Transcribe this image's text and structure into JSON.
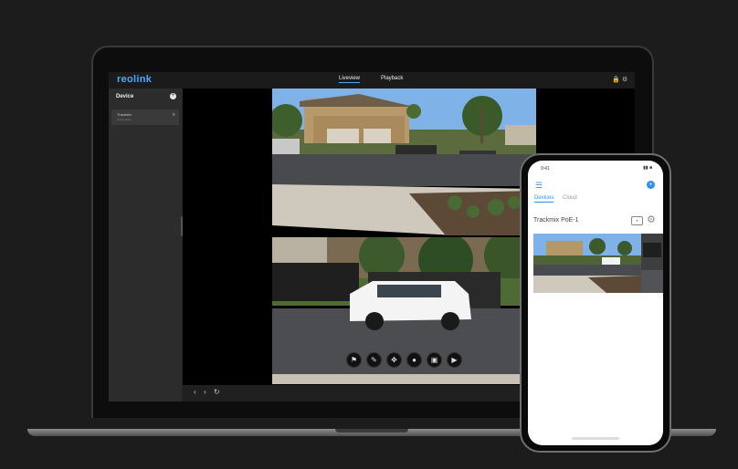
{
  "app": {
    "logo": "reolink",
    "nav_tabs": [
      {
        "label": "Liveview",
        "active": true
      },
      {
        "label": "Playback",
        "active": false
      }
    ],
    "header_icons": [
      "lock-icon",
      "gear-icon"
    ]
  },
  "sidebar": {
    "title": "Device",
    "add_icon": "plus-icon",
    "items": [
      {
        "name": "Trackmix",
        "status": "Connected"
      }
    ]
  },
  "toolbar": {
    "buttons": [
      "bell-icon",
      "pen-icon",
      "ptz-icon",
      "microphone-icon",
      "snapshot-icon",
      "record-icon"
    ]
  },
  "bottombar": {
    "icons": [
      "chevron-left-icon",
      "chevron-right-icon",
      "refresh-icon"
    ]
  },
  "phone": {
    "status_time": "9:41",
    "tabs": [
      {
        "label": "Devices",
        "active": true
      },
      {
        "label": "Cloud",
        "active": false
      }
    ],
    "device_name": "Trackmix PoE-1"
  },
  "colors": {
    "accent": "#2f8fea",
    "background": "#1c1c1c",
    "sidebar": "#2c2c2c"
  }
}
